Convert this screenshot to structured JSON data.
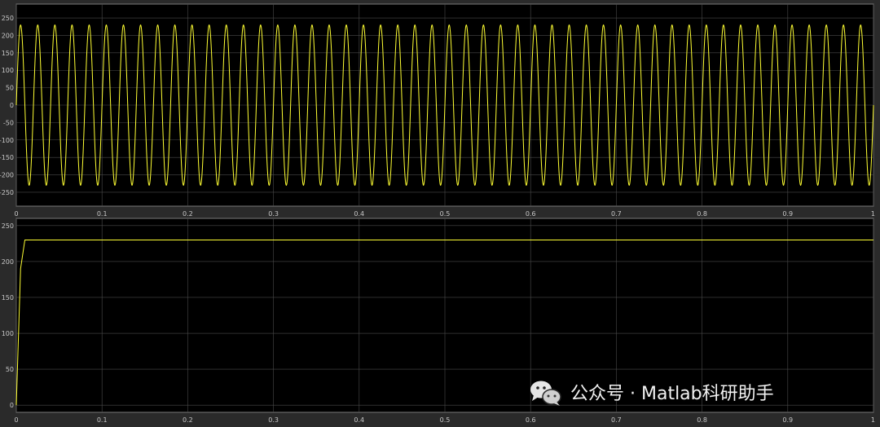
{
  "chart_data": [
    {
      "type": "line",
      "title": "",
      "xlabel": "",
      "ylabel": "",
      "xlim": [
        0,
        1
      ],
      "ylim": [
        -290,
        290
      ],
      "x_ticks": [
        0,
        0.1,
        0.2,
        0.3,
        0.4,
        0.5,
        0.6,
        0.7,
        0.8,
        0.9,
        1
      ],
      "y_ticks": [
        -250,
        -200,
        -150,
        -100,
        -50,
        0,
        50,
        100,
        150,
        200,
        250
      ],
      "grid": true,
      "series": [
        {
          "color": "#ffff33",
          "waveform": "sine",
          "amplitude": 230,
          "frequency_hz": 50,
          "x_range": [
            0,
            1
          ]
        }
      ]
    },
    {
      "type": "line",
      "title": "",
      "xlabel": "",
      "ylabel": "",
      "xlim": [
        0,
        1
      ],
      "ylim": [
        -10,
        260
      ],
      "x_ticks": [
        0,
        0.1,
        0.2,
        0.3,
        0.4,
        0.5,
        0.6,
        0.7,
        0.8,
        0.9,
        1
      ],
      "y_ticks": [
        0,
        50,
        100,
        150,
        200,
        250
      ],
      "grid": true,
      "series": [
        {
          "color": "#ffff33",
          "x": [
            0,
            0.005,
            0.01,
            1
          ],
          "y": [
            0,
            190,
            230,
            230
          ]
        }
      ]
    }
  ],
  "watermark": {
    "icon": "wechat-icon",
    "text": "公众号 · Matlab科研助手"
  }
}
